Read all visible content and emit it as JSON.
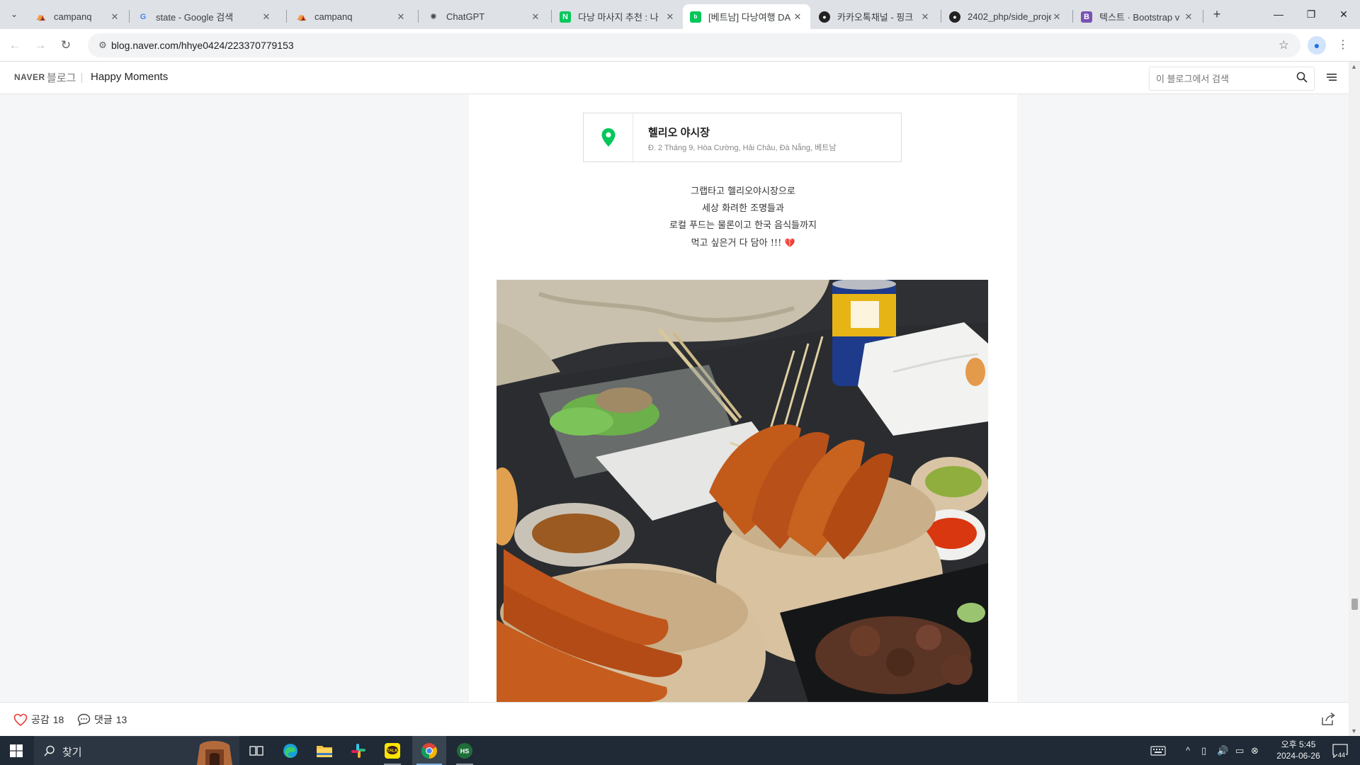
{
  "browser": {
    "tabs": [
      {
        "title": "campanq",
        "favicon": "campanq-logo-icon",
        "active": false
      },
      {
        "title": "state - Google 검색",
        "favicon": "google-g-icon",
        "active": false
      },
      {
        "title": "campanq",
        "favicon": "campanq-logo-icon",
        "active": false
      },
      {
        "title": "ChatGPT",
        "favicon": "chatgpt-logo-icon",
        "active": false
      },
      {
        "title": "다낭 마사지 추천 : 나",
        "favicon": "naver-n-icon",
        "active": false
      },
      {
        "title": "[베트남] 다낭여행 DA",
        "favicon": "naver-blog-icon",
        "active": true
      },
      {
        "title": "카카오톡채널 - 핑크",
        "favicon": "kakaotalk-channel-icon",
        "active": false
      },
      {
        "title": "2402_php/side_proje",
        "favicon": "github-icon",
        "active": false
      },
      {
        "title": "텍스트 · Bootstrap v",
        "favicon": "bootstrap-icon",
        "active": false
      }
    ],
    "url": "blog.naver.com/hhye0424/223370779153"
  },
  "blog": {
    "brand": "NAVER",
    "blog_word": "블로그",
    "blog_name": "Happy Moments",
    "search_placeholder": "이 블로그에서 검색"
  },
  "post": {
    "place_name": "헬리오 야시장",
    "place_address": "Đ. 2 Tháng 9, Hòa Cường, Hải Châu, Đà Nẵng, 베트남",
    "lines": [
      "그랩타고 헬리오야시장으로",
      "세상 화려한 조명들과",
      "로컬 푸드는 물론이고 한국 음식들까지",
      "먹고 싶은거 다 담아 !!!"
    ],
    "photo_icon": "street-food-photo"
  },
  "actions": {
    "like_label": "공감",
    "like_count": "18",
    "comment_label": "댓글",
    "comment_count": "13"
  },
  "taskbar": {
    "search_label": "찾기",
    "time": "오후 5:45",
    "date": "2024-06-26",
    "notification_count": "44"
  },
  "colors": {
    "naver_green": "#03c75a",
    "taskbar_bg": "#1f2a36",
    "heart_red": "#c62a3a"
  }
}
